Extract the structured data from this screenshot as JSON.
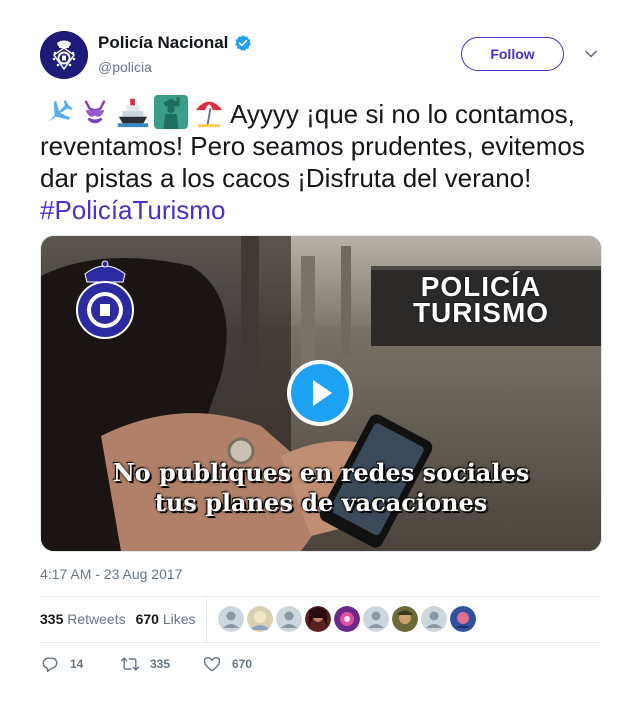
{
  "author": {
    "display_name": "Policía Nacional",
    "handle": "@policia",
    "verified": true
  },
  "header": {
    "follow_label": "Follow"
  },
  "tweet": {
    "emojis": [
      "airplane-icon",
      "bikini-icon",
      "cruise-ship-icon",
      "statue-of-liberty-icon",
      "beach-umbrella-icon"
    ],
    "text": "Ayyyy ¡que si no lo contamos, reventamos! Pero seamos prudentes, evitemos dar pistas a los cacos ¡Disfruta del verano! ",
    "hashtag": "#PolicíaTurismo",
    "timestamp": "4:17 AM - 23 Aug 2017"
  },
  "media": {
    "brand_line1": "POLICÍA",
    "brand_line2": "TURISMO",
    "caption_line1": "No publiques en redes sociales",
    "caption_line2": "tus planes de vacaciones"
  },
  "stats": {
    "retweets_count": "335",
    "retweets_label": "Retweets",
    "likes_count": "670",
    "likes_label": "Likes",
    "likers": [
      "avatar-default",
      "avatar-photo",
      "avatar-default",
      "avatar-photo",
      "avatar-photo",
      "avatar-default",
      "avatar-photo",
      "avatar-default",
      "avatar-photo"
    ]
  },
  "actions": {
    "reply_count": "14",
    "retweet_count": "335",
    "like_count": "670"
  },
  "colors": {
    "accent": "#4b2fd0",
    "play": "#1da1f2",
    "muted": "#657786"
  }
}
